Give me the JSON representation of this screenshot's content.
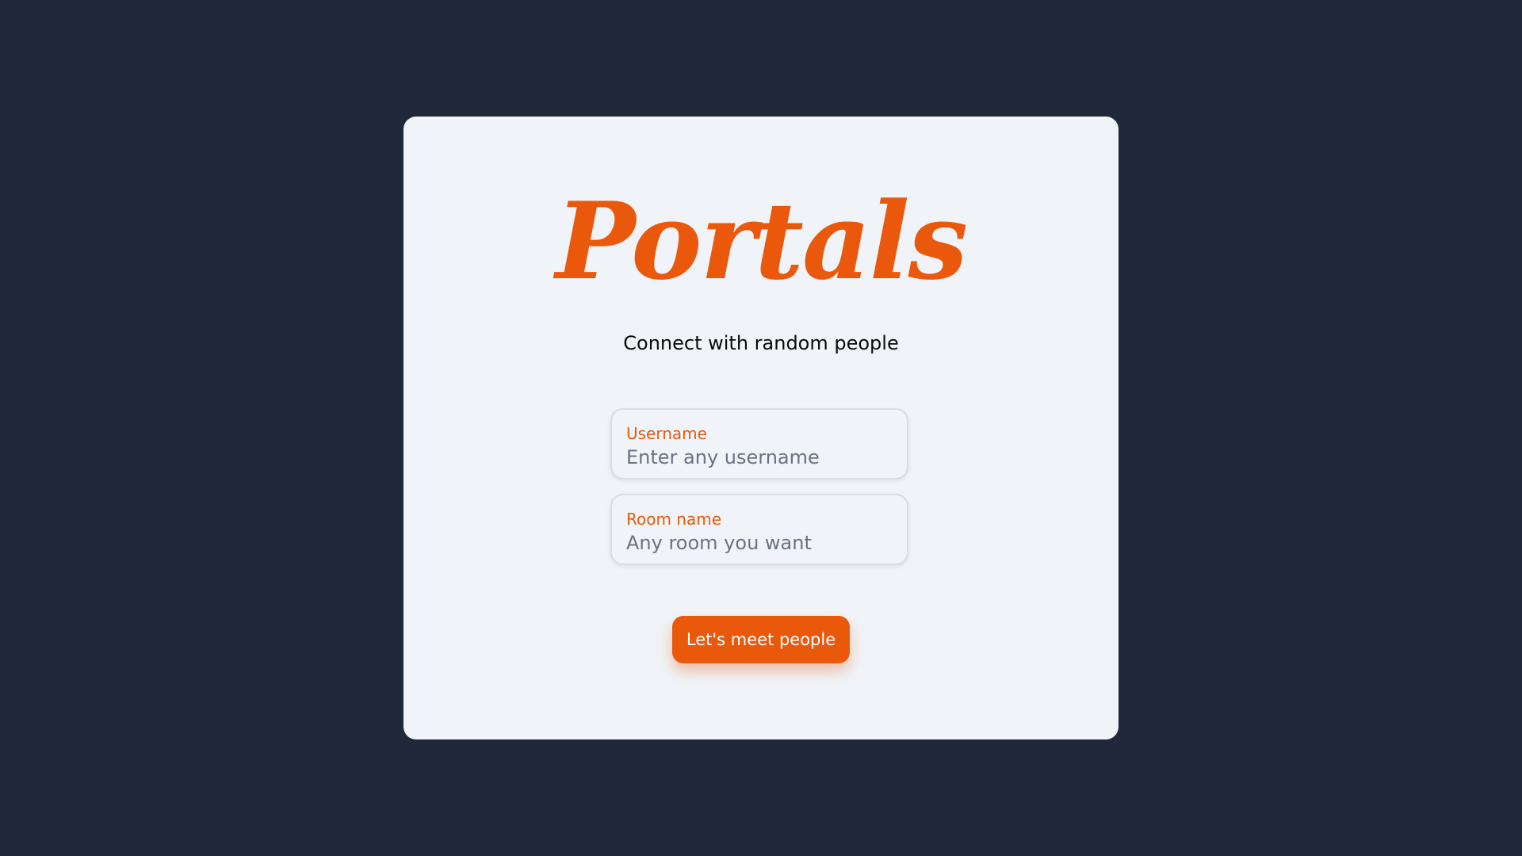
{
  "app": {
    "logo_text": "Portals",
    "subtitle": "Connect with random people"
  },
  "form": {
    "username": {
      "label": "Username",
      "placeholder": "Enter any username",
      "value": ""
    },
    "room": {
      "label": "Room name",
      "placeholder": "Any room you want",
      "value": ""
    },
    "submit_label": "Let's meet people"
  },
  "colors": {
    "background": "#1f2839",
    "card": "#f0f4f8",
    "accent": "#ea580c",
    "placeholder": "#6b7280"
  }
}
